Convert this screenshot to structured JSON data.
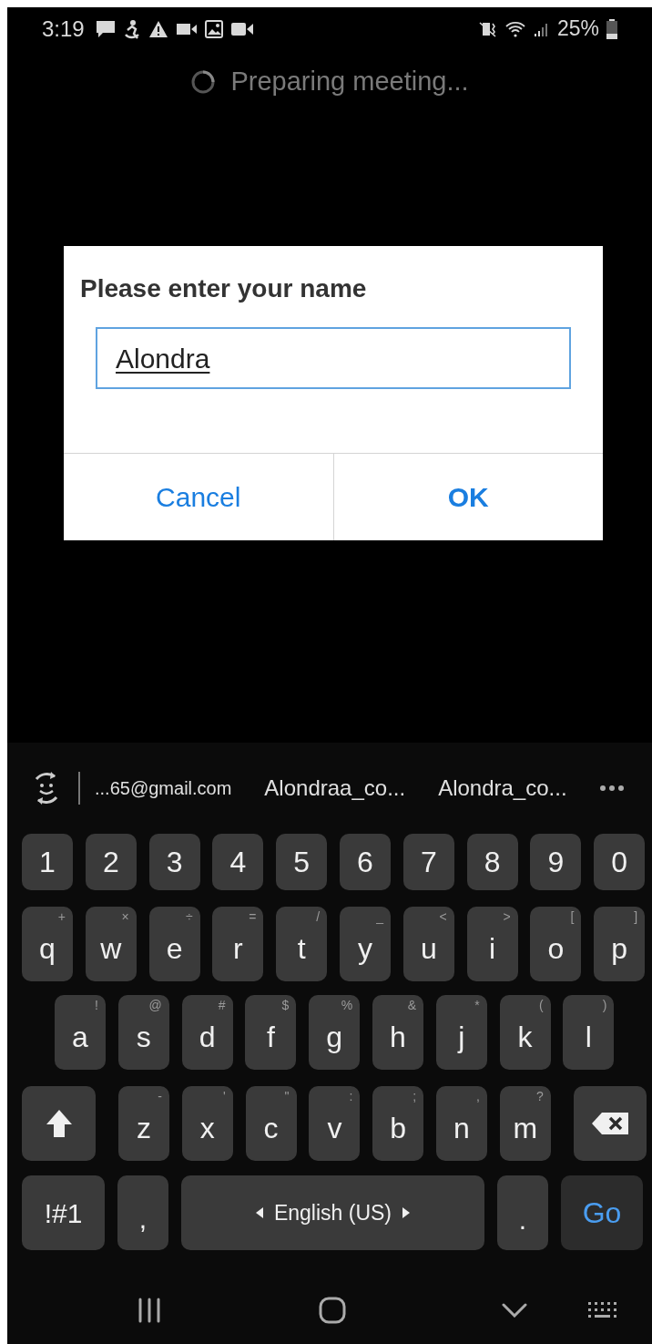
{
  "status_bar": {
    "time": "3:19",
    "battery": "25%"
  },
  "loading_text": "Preparing meeting...",
  "dialog": {
    "title": "Please enter your name",
    "input": {
      "value": "Alondra",
      "composing": true
    },
    "buttons": [
      {
        "label": "Cancel",
        "primary": false
      },
      {
        "label": "OK",
        "primary": true
      }
    ]
  },
  "keyboard": {
    "suggestions": [
      "...65@gmail.com",
      "Alondraa_co...",
      "Alondra_co..."
    ],
    "number_row": [
      "1",
      "2",
      "3",
      "4",
      "5",
      "6",
      "7",
      "8",
      "9",
      "0"
    ],
    "letter_rows": [
      [
        {
          "label": "q",
          "hint": "+"
        },
        {
          "label": "w",
          "hint": "×"
        },
        {
          "label": "e",
          "hint": "÷"
        },
        {
          "label": "r",
          "hint": "="
        },
        {
          "label": "t",
          "hint": "/"
        },
        {
          "label": "y",
          "hint": "_"
        },
        {
          "label": "u",
          "hint": "<"
        },
        {
          "label": "i",
          "hint": ">"
        },
        {
          "label": "o",
          "hint": "["
        },
        {
          "label": "p",
          "hint": "]"
        }
      ],
      [
        {
          "label": "a",
          "hint": "!"
        },
        {
          "label": "s",
          "hint": "@"
        },
        {
          "label": "d",
          "hint": "#"
        },
        {
          "label": "f",
          "hint": "$"
        },
        {
          "label": "g",
          "hint": "%"
        },
        {
          "label": "h",
          "hint": "&"
        },
        {
          "label": "j",
          "hint": "*"
        },
        {
          "label": "k",
          "hint": "("
        },
        {
          "label": "l",
          "hint": ")"
        }
      ],
      [
        {
          "label": "z",
          "hint": "-"
        },
        {
          "label": "x",
          "hint": "'"
        },
        {
          "label": "c",
          "hint": "\""
        },
        {
          "label": "v",
          "hint": ":"
        },
        {
          "label": "b",
          "hint": ";"
        },
        {
          "label": "n",
          "hint": ","
        },
        {
          "label": "m",
          "hint": "?"
        }
      ]
    ],
    "bottom_row": {
      "symbols": "!#1",
      "comma": ",",
      "space": "English (US)",
      "period": ".",
      "action": "Go"
    }
  }
}
